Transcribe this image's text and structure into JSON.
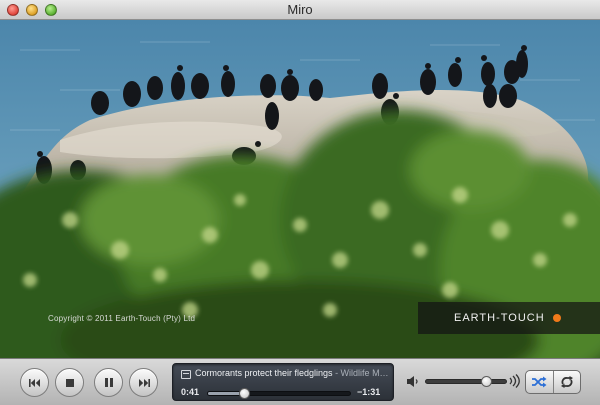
{
  "window": {
    "title": "Miro"
  },
  "video": {
    "copyright": "Copyright © 2011 Earth-Touch (Pty) Ltd",
    "watermark": "EARTH-TOUCH"
  },
  "player": {
    "now_playing": "Cormorants protect their fledglings",
    "now_playing_source": " - Wildlife M…",
    "elapsed": "0:41",
    "remaining": "−1:31",
    "progress_fraction": 0.25,
    "volume_fraction": 0.75
  },
  "colors": {
    "accent_orange": "#f07a1a",
    "toggle_blue": "#2c6fd6"
  },
  "icons": {
    "prev": "skip-back-icon",
    "stop": "stop-icon",
    "pause": "pause-icon",
    "next": "skip-forward-icon",
    "shuffle": "shuffle-icon",
    "repeat": "repeat-icon"
  }
}
